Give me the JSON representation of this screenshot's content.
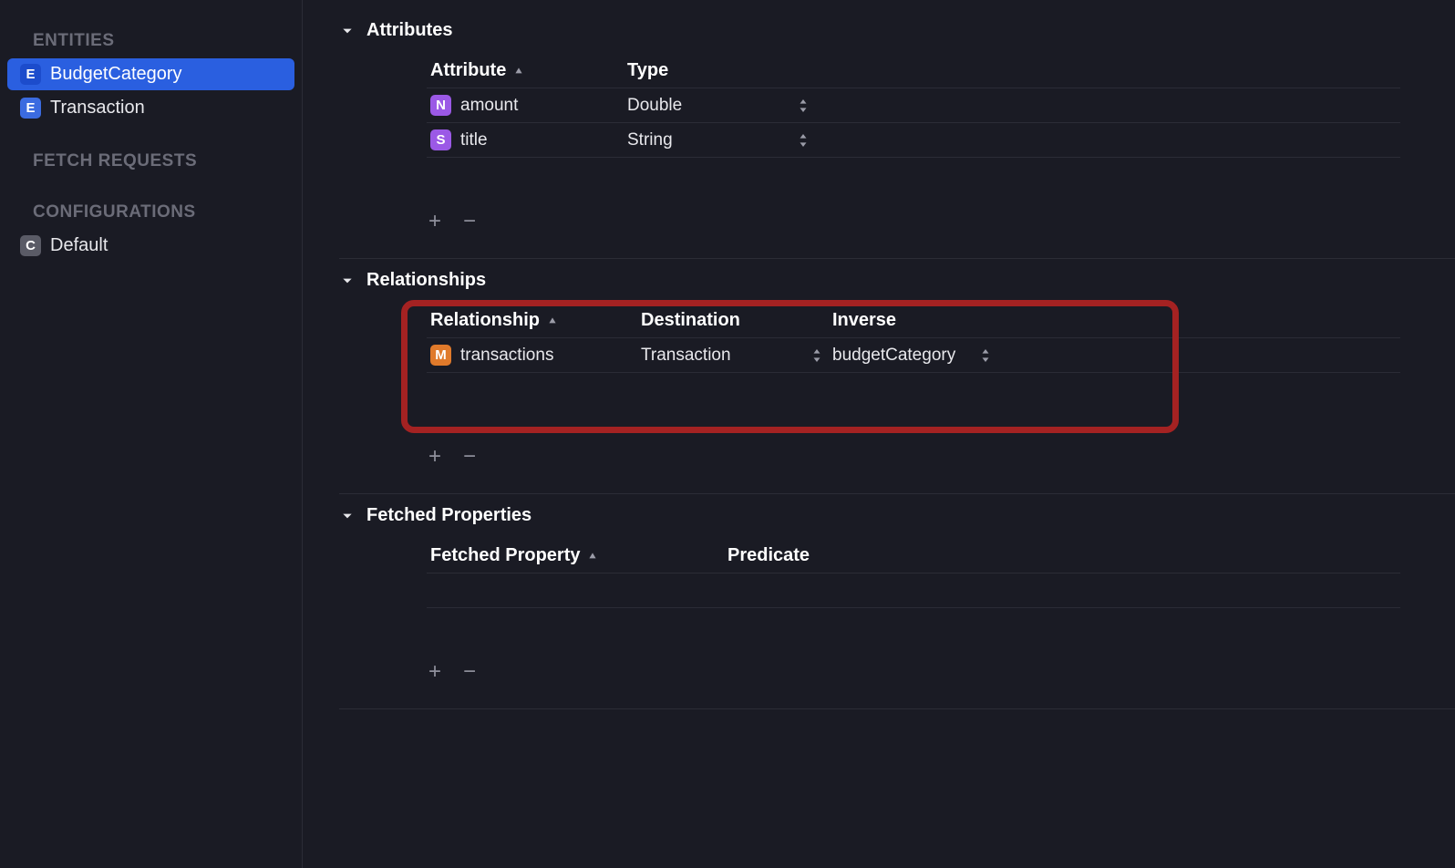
{
  "sidebar": {
    "entities_header": "ENTITIES",
    "entities": [
      {
        "label": "BudgetCategory",
        "selected": true
      },
      {
        "label": "Transaction",
        "selected": false
      }
    ],
    "fetch_requests_header": "FETCH REQUESTS",
    "configurations_header": "CONFIGURATIONS",
    "configurations": [
      {
        "label": "Default"
      }
    ]
  },
  "attributes": {
    "title": "Attributes",
    "headers": {
      "name": "Attribute",
      "type": "Type"
    },
    "rows": [
      {
        "badge": "N",
        "name": "amount",
        "type": "Double"
      },
      {
        "badge": "S",
        "name": "title",
        "type": "String"
      }
    ]
  },
  "relationships": {
    "title": "Relationships",
    "headers": {
      "name": "Relationship",
      "dest": "Destination",
      "inv": "Inverse"
    },
    "rows": [
      {
        "badge": "M",
        "name": "transactions",
        "destination": "Transaction",
        "inverse": "budgetCategory"
      }
    ]
  },
  "fetched_properties": {
    "title": "Fetched Properties",
    "headers": {
      "name": "Fetched Property",
      "pred": "Predicate"
    }
  }
}
